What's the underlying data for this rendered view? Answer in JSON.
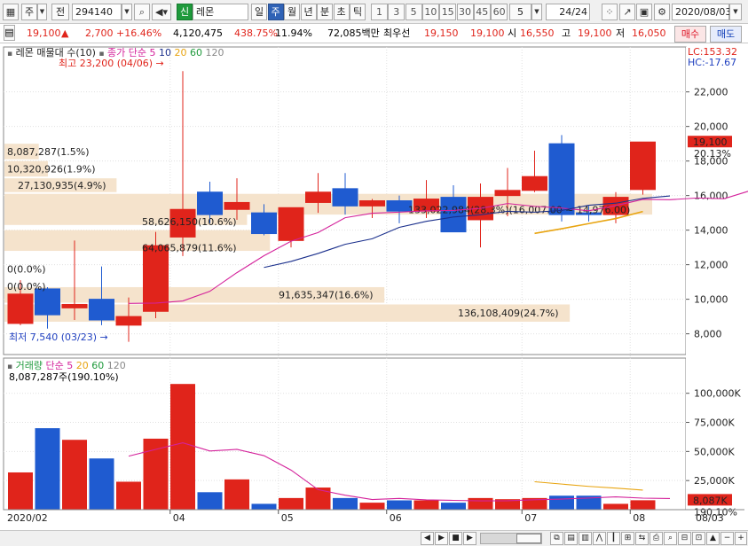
{
  "toolbar": {
    "market_label": "주",
    "prev_label": "전",
    "stock_code": "294140",
    "search_icon": "search-icon",
    "sound_icon": "speaker-icon",
    "new_badge": "신",
    "stock_name": "레몬",
    "periods": [
      "일",
      "주",
      "월",
      "년",
      "분",
      "초",
      "틱"
    ],
    "active_period": "주",
    "intervals": [
      "1",
      "3",
      "5",
      "10",
      "15",
      "30",
      "45",
      "60"
    ],
    "interval_value": "5",
    "page_count": "24",
    "page_total": "/24",
    "date_value": "2020/08/03"
  },
  "infobar": {
    "price": "19,100",
    "change": "2,700",
    "change_pct": "+16.46%",
    "volume": "4,120,475",
    "volume_ratio": "438.75%",
    "turnover": "11.94%",
    "amount": "72,085백만",
    "best_label": "최우선",
    "best_ask": "19,150",
    "best_bid": "19,100",
    "open_label": "시",
    "open": "16,550",
    "high_label": "고",
    "high": "19,100",
    "low_label": "저",
    "low": "16,050",
    "buy_label": "매수",
    "sell_label": "매도"
  },
  "price_legend": {
    "title": "레몬 매물대 수(10)",
    "ma_label": "종가 단순",
    "ma_periods": [
      "5",
      "10",
      "20",
      "60",
      "120"
    ],
    "lc": "LC:153.32",
    "hc": "HC:-17.67",
    "high_annotation": "최고 23,200 (04/06)",
    "low_annotation": "최저 7,540 (03/23)"
  },
  "volume_legend": {
    "title": "거래량",
    "ma_label": "단순",
    "ma_periods": [
      "5",
      "20",
      "60",
      "120"
    ],
    "current": "8,087,287주(190.10%)"
  },
  "colors": {
    "up": "#e0241b",
    "down": "#1f5bd0",
    "ma5": "#d4229b",
    "ma10": "#1a2f8c",
    "ma20": "#e8a410",
    "ma60": "#1f9a3c",
    "ma120": "#888888",
    "volume_profile": "#f5e3cc"
  },
  "chart_data": [
    {
      "type": "candlestick",
      "title": "",
      "ylim": [
        6800,
        24600
      ],
      "y_ticks": [
        "8,000",
        "10,000",
        "12,000",
        "14,000",
        "16,000",
        "18,000",
        "20,000",
        "22,000"
      ],
      "y_tick_values": [
        8000,
        10000,
        12000,
        14000,
        16000,
        18000,
        20000,
        22000
      ],
      "current_price_label": "19,100",
      "current_pct_label": "20.13%",
      "x_labels": [
        "2020/02",
        "04",
        "05",
        "06",
        "07",
        "08",
        "08/03"
      ],
      "x_label_index": [
        0,
        6,
        10,
        14,
        19,
        23,
        25.5
      ],
      "candles": [
        {
          "o": 8600,
          "h": 11100,
          "l": 8500,
          "c": 10300
        },
        {
          "o": 10600,
          "h": 10700,
          "l": 8300,
          "c": 9100
        },
        {
          "o": 9500,
          "h": 13400,
          "l": 8800,
          "c": 9700
        },
        {
          "o": 10000,
          "h": 11900,
          "l": 8500,
          "c": 8800
        },
        {
          "o": 8500,
          "h": 10100,
          "l": 7540,
          "c": 9000
        },
        {
          "o": 9300,
          "h": 13900,
          "l": 8900,
          "c": 13100
        },
        {
          "o": 13600,
          "h": 23200,
          "l": 12500,
          "c": 15200
        },
        {
          "o": 16200,
          "h": 16800,
          "l": 14400,
          "c": 14900
        },
        {
          "o": 15200,
          "h": 17000,
          "l": 14600,
          "c": 15600
        },
        {
          "o": 15000,
          "h": 15500,
          "l": 13700,
          "c": 13800
        },
        {
          "o": 13400,
          "h": 15300,
          "l": 13000,
          "c": 15300
        },
        {
          "o": 15600,
          "h": 17300,
          "l": 15000,
          "c": 16200
        },
        {
          "o": 16400,
          "h": 17300,
          "l": 14900,
          "c": 15400
        },
        {
          "o": 15400,
          "h": 15800,
          "l": 14700,
          "c": 15700
        },
        {
          "o": 15700,
          "h": 16000,
          "l": 14400,
          "c": 15100
        },
        {
          "o": 15100,
          "h": 16900,
          "l": 14700,
          "c": 15800
        },
        {
          "o": 15900,
          "h": 16600,
          "l": 13900,
          "c": 13900
        },
        {
          "o": 14600,
          "h": 16700,
          "l": 13000,
          "c": 15900
        },
        {
          "o": 16000,
          "h": 17600,
          "l": 14800,
          "c": 16300
        },
        {
          "o": 16300,
          "h": 18600,
          "l": 16200,
          "c": 17100
        },
        {
          "o": 19000,
          "h": 19500,
          "l": 14500,
          "c": 14900
        },
        {
          "o": 15000,
          "h": 15400,
          "l": 14500,
          "c": 14900
        },
        {
          "o": 14900,
          "h": 16200,
          "l": 14400,
          "c": 15900
        },
        {
          "o": 16350,
          "h": 19100,
          "l": 16050,
          "c": 19100
        }
      ],
      "ma_lines": [
        {
          "name": "5",
          "start": 4,
          "values": [
            9760,
            9780,
            9900,
            10460,
            11540,
            12520,
            13360,
            13860,
            14720,
            14980,
            15040,
            15120,
            15140,
            15260,
            15540,
            15380,
            15280,
            15120,
            15420,
            15780,
            15760,
            15860,
            15820,
            16300
          ]
        },
        {
          "name": "10",
          "start": 9,
          "values": [
            11840,
            12190,
            12650,
            13180,
            13500,
            14160,
            14510,
            14760,
            14890,
            15090,
            15040,
            15140,
            15440,
            15560,
            15840,
            15980
          ]
        },
        {
          "name": "20",
          "start": 19,
          "values": [
            13810,
            14080,
            14380,
            14670,
            15080
          ]
        }
      ],
      "volume_profile": [
        {
          "label": "8,087,287(1.5%)",
          "price_low": 18100,
          "price_high": 19000,
          "pct": 1.5
        },
        {
          "label": "10,320,926(1.9%)",
          "price_low": 17100,
          "price_high": 18000,
          "pct": 1.9
        },
        {
          "label": "27,130,935(4.9%)",
          "price_low": 16200,
          "price_high": 17000,
          "pct": 4.9
        },
        {
          "label": "58,626,150(10.6%)",
          "price_low": 14300,
          "price_high": 15300,
          "pct": 10.6
        },
        {
          "label": "64,065,879(11.6%)",
          "price_low": 12800,
          "price_high": 14000,
          "pct": 11.6
        },
        {
          "label": "0(0.0%)",
          "price_low": 11600,
          "price_high": 11900,
          "pct": 0.0
        },
        {
          "label": "0(0.0%)",
          "price_low": 10600,
          "price_high": 10900,
          "pct": 0.0
        },
        {
          "label": "91,635,347(16.6%)",
          "price_low": 9800,
          "price_high": 10700,
          "pct": 16.6
        },
        {
          "label": "136,108,409(24.7%)",
          "price_low": 8700,
          "price_high": 9700,
          "pct": 24.7
        },
        {
          "label": "133,022,984(28.3%)(16,007.00 ~ 14,976.00)",
          "price_low": 14900,
          "price_high": 16100,
          "pct": 28.3
        }
      ]
    },
    {
      "type": "bar",
      "title": "",
      "ylim": [
        0,
        115000
      ],
      "y_ticks": [
        "25,000K",
        "50,000K",
        "75,000K",
        "100,000K"
      ],
      "y_tick_values": [
        25000,
        50000,
        75000,
        100000
      ],
      "current_label": "8,087K",
      "current_pct_label": "190.10%",
      "values": [
        32000,
        70000,
        60000,
        44000,
        24000,
        61000,
        108000,
        15000,
        26000,
        5000,
        10000,
        19000,
        10000,
        6000,
        8000,
        8000,
        6000,
        10000,
        9000,
        10000,
        12000,
        12000,
        5000,
        8087
      ],
      "ma_lines": [
        {
          "name": "5",
          "start": 4,
          "values": [
            46000,
            51800,
            57400,
            50400,
            51800,
            46400,
            34000,
            17200,
            12400,
            8700,
            9700,
            8400,
            8000,
            7600,
            7700,
            8500,
            9100,
            10000,
            11000,
            9900,
            9600
          ]
        },
        {
          "name": "20",
          "start": 19,
          "values": [
            24000,
            22000,
            20000,
            18500,
            16800
          ]
        }
      ]
    }
  ]
}
